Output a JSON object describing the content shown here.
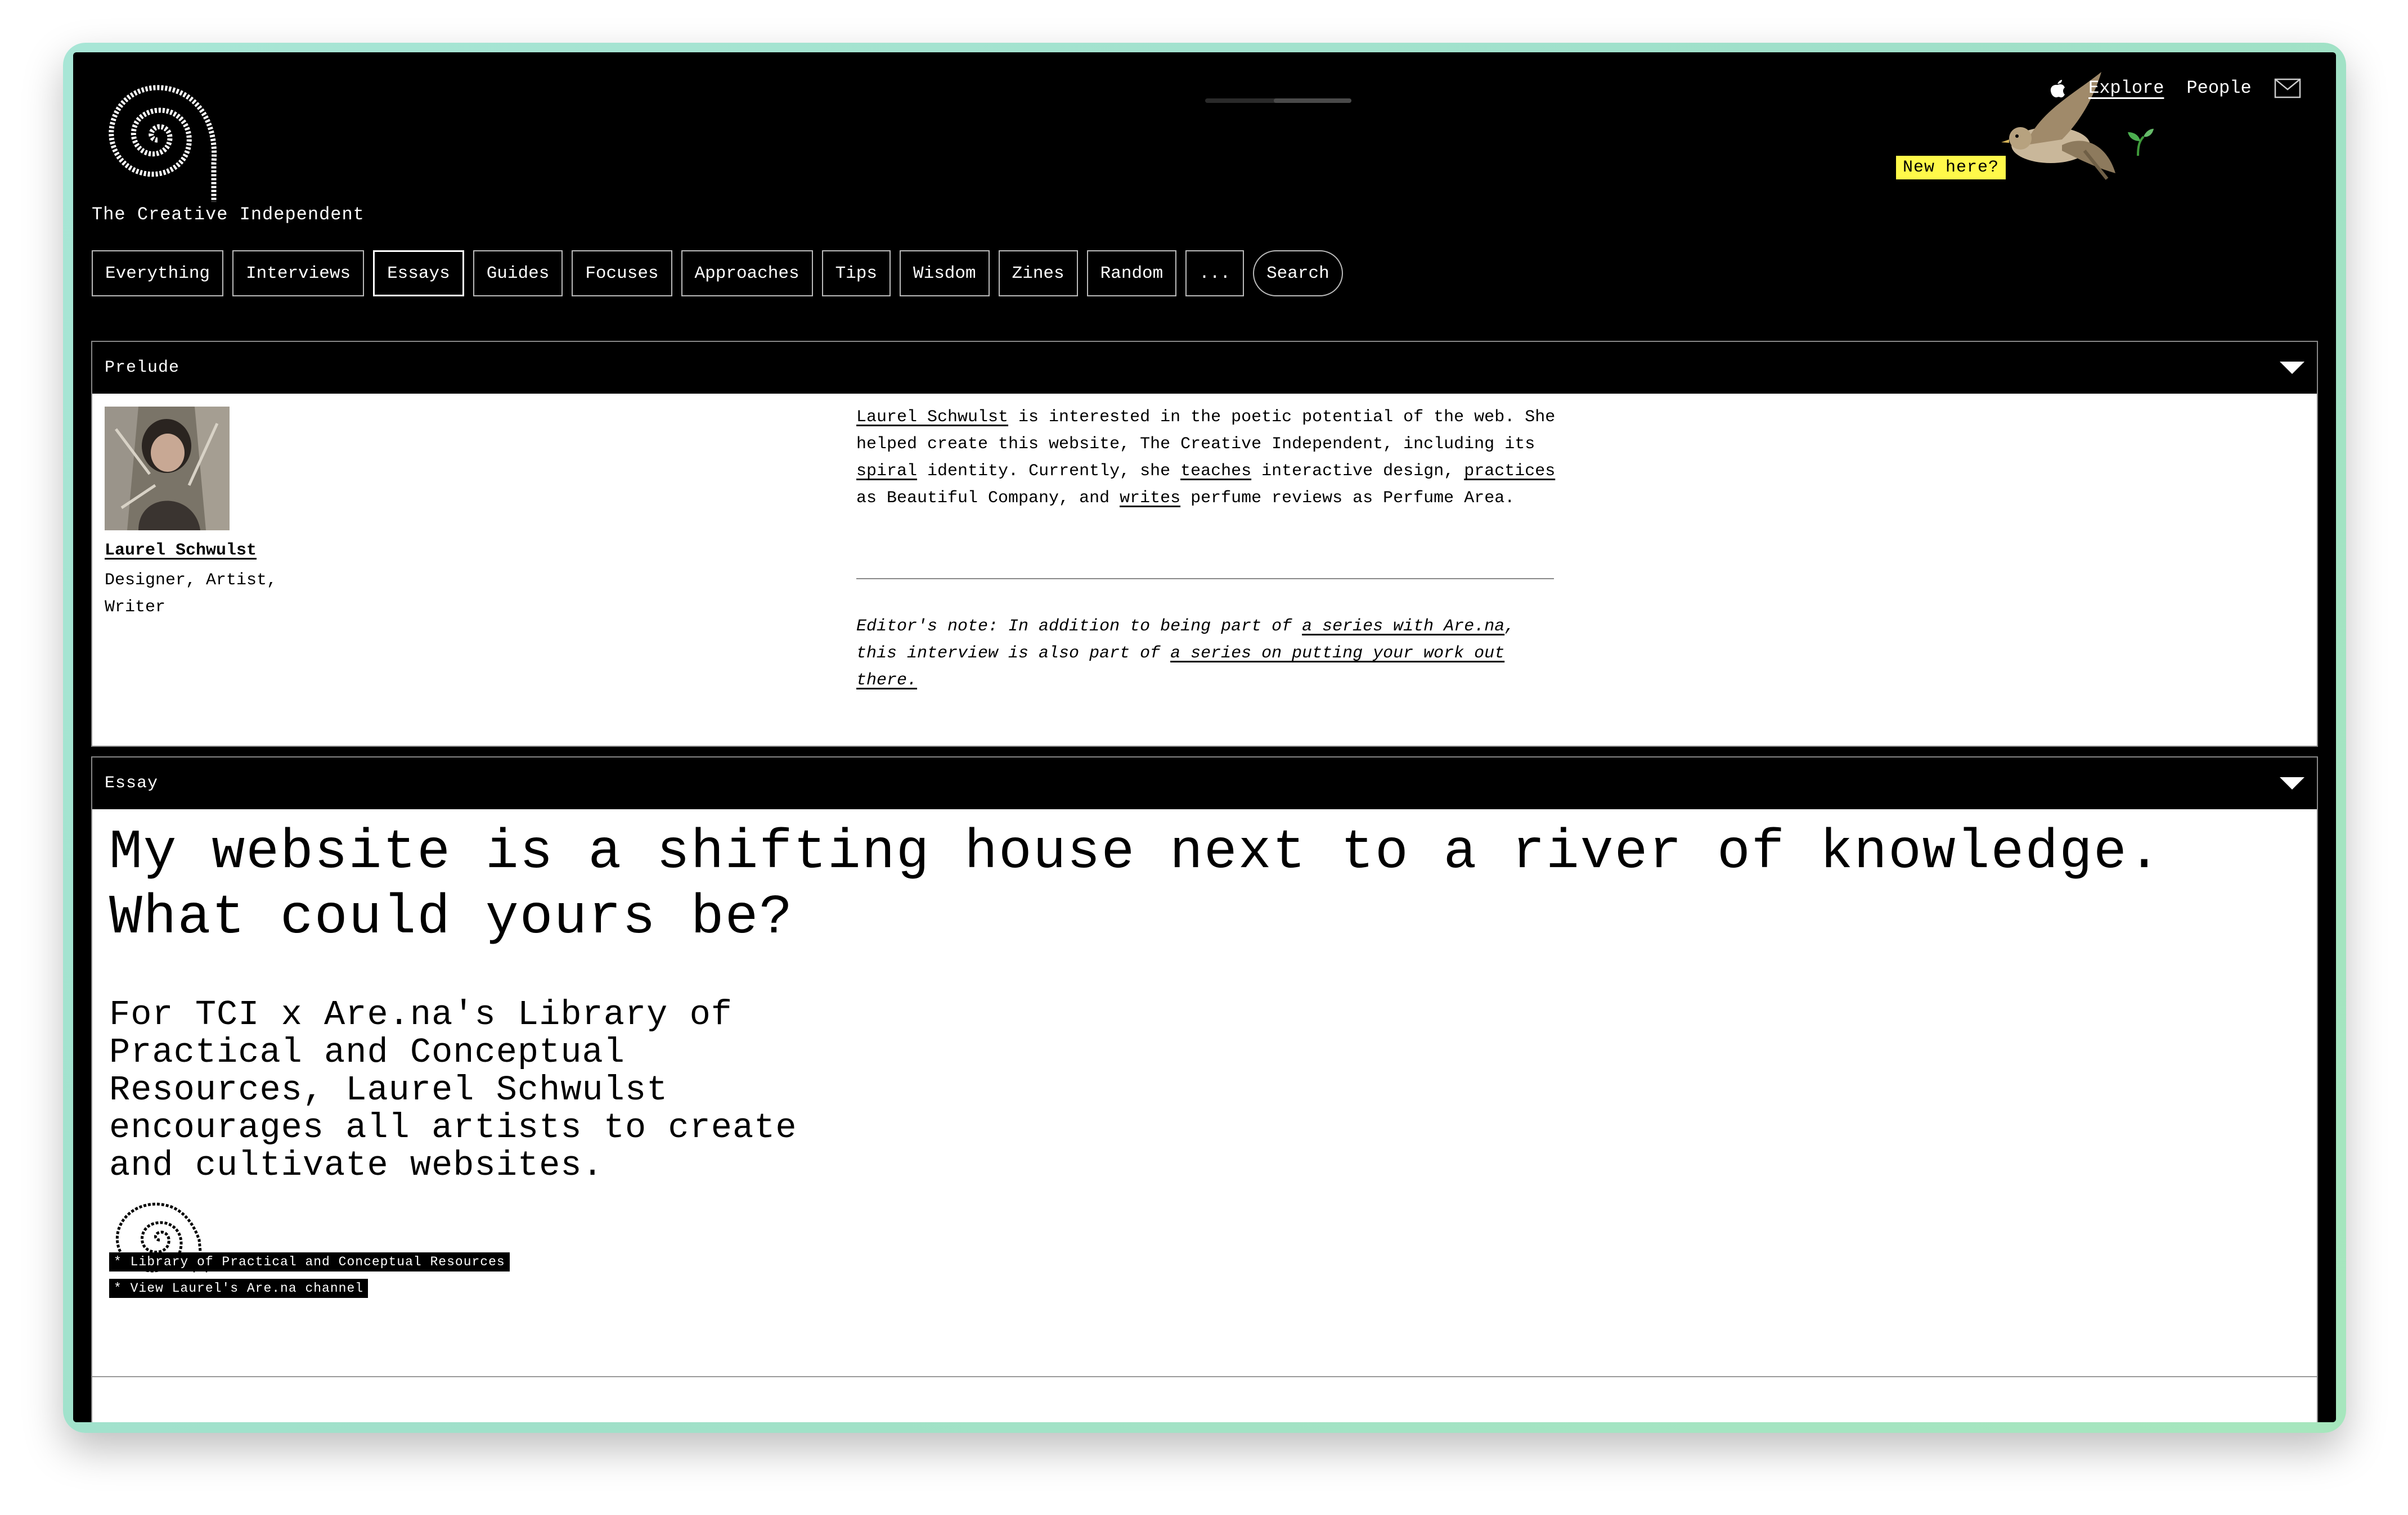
{
  "site": {
    "name": "The Creative Independent"
  },
  "nav": {
    "tabs": [
      "Everything",
      "Interviews",
      "Essays",
      "Guides",
      "Focuses",
      "Approaches",
      "Tips",
      "Wisdom",
      "Zines",
      "Random",
      "..."
    ],
    "active": "Essays",
    "search_label": "Search"
  },
  "header": {
    "new_here": "New here?",
    "explore": "Explore",
    "people": "People"
  },
  "prelude": {
    "heading": "Prelude",
    "person_name": "Laurel Schwulst",
    "person_role": "Designer, Artist, Writer",
    "bio": {
      "name_link": "Laurel Schwulst",
      "t1": " is interested in the poetic potential of the web. She helped create this website, The Creative Independent, including its ",
      "spiral_link": "spiral",
      "t2": " identity. Currently, she ",
      "teaches_link": "teaches",
      "t3": " interactive design, ",
      "practices_link": "practices",
      "t4": " as Beautiful Company, and ",
      "writes_link": "writes",
      "t5": " perfume reviews as Perfume Area."
    },
    "note": {
      "t1": "Editor's note: In addition to being part of ",
      "link1": "a series with Are.na",
      "t2": ", this interview is also part of ",
      "link2": "a series on putting your work out there."
    }
  },
  "essay": {
    "heading": "Essay",
    "title": "My website is a shifting house next to a river of knowledge. What could yours be?",
    "subtitle": "For TCI x Are.na's Library of Practical and Conceptual Resources, Laurel Schwulst encourages all artists to create and cultivate websites.",
    "tags": [
      "* Library of Practical and Conceptual Resources",
      "* View Laurel's Are.na channel"
    ]
  },
  "colors": {
    "background": "#000000",
    "highlight": "#fff94a",
    "frame": "#a6e6cf"
  }
}
